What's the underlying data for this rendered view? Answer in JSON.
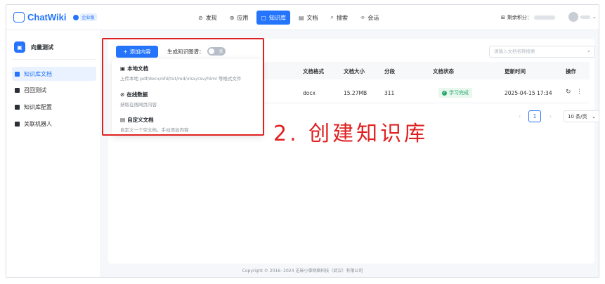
{
  "app": {
    "name": "ChatWiki",
    "edition_badge": "企业版"
  },
  "nav": {
    "items": [
      {
        "icon": "⊘",
        "label": "发现"
      },
      {
        "icon": "⊕",
        "label": "应用"
      },
      {
        "icon": "▢",
        "label": "知识库"
      },
      {
        "icon": "▤",
        "label": "文档"
      },
      {
        "icon": "⌕",
        "label": "搜索"
      },
      {
        "icon": "⌯",
        "label": "会话"
      }
    ],
    "active_index": 2
  },
  "account": {
    "points_label": "剩余积分："
  },
  "sidebar": {
    "kb_icon": "▣",
    "kb_name": "向量测试",
    "items": [
      {
        "label": "知识库文档",
        "active": true
      },
      {
        "label": "召回测试",
        "active": false
      },
      {
        "label": "知识库配置",
        "active": false
      },
      {
        "label": "关联机器人",
        "active": false
      }
    ]
  },
  "toolbar": {
    "add_button_label": "添加内容",
    "graph_label": "生成知识图谱：",
    "graph_toggle_label": "关",
    "search_placeholder": "请输入文档名称搜索"
  },
  "table": {
    "headers": [
      "文档格式",
      "文档大小",
      "分段",
      "文档状态",
      "更新时间",
      "操作"
    ],
    "rows": [
      {
        "format": "docx",
        "size": "15.27MB",
        "segments": "311",
        "status": "学习完成",
        "updated": "2025-04-15 17:34"
      }
    ]
  },
  "pagination": {
    "current_page": "1",
    "page_size": "10 条/页"
  },
  "dropdown": {
    "items": [
      {
        "icon": "▣",
        "title": "本地文档",
        "desc": "上传本地 pdf/docx/ofd/txt/md/xlsx/csv/html 等格式文件"
      },
      {
        "icon": "⊘",
        "title": "在线数据",
        "desc": "获取在线网页内容"
      },
      {
        "icon": "▤",
        "title": "自定义文档",
        "desc": "自定义一个空文档，手动添加内容"
      }
    ]
  },
  "annotation": "2. 创建知识库",
  "footer": "Copyright © 2016- 2024 芝麻小事网络科技（武汉）有限公司",
  "colors": {
    "accent": "#2475fc",
    "annotation_red": "#e02020",
    "success": "#26a86b"
  }
}
